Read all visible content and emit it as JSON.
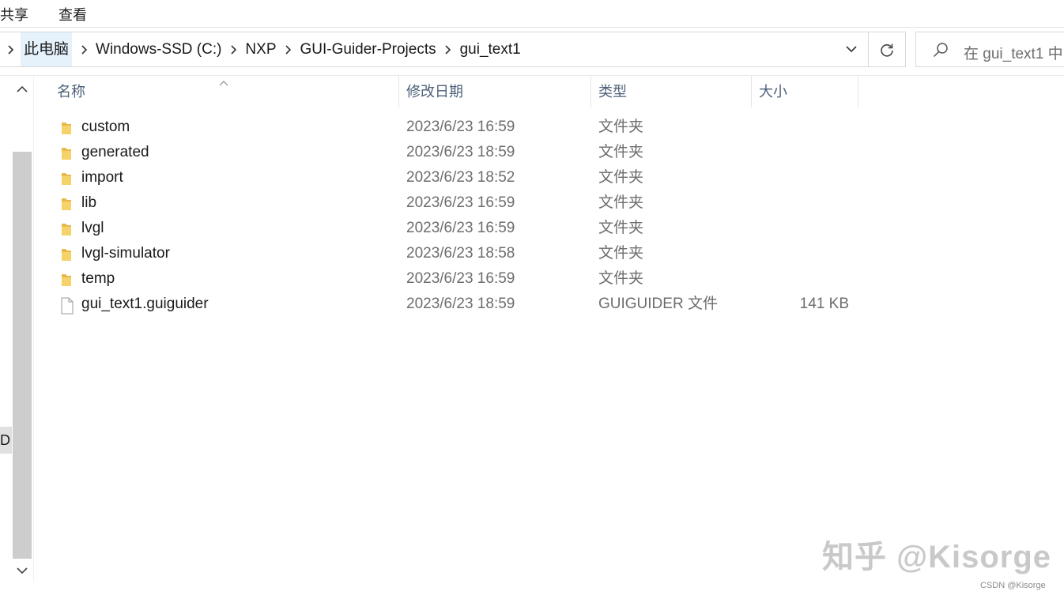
{
  "ribbon": {
    "tabs": [
      "共享",
      "查看"
    ]
  },
  "address_bar": {
    "breadcrumbs": [
      "此电脑",
      "Windows-SSD (C:)",
      "NXP",
      "GUI-Guider-Projects",
      "gui_text1"
    ]
  },
  "search": {
    "placeholder": "在 gui_text1 中"
  },
  "nav_pane": {
    "partial_label": "D"
  },
  "columns": {
    "name": "名称",
    "date": "修改日期",
    "type": "类型",
    "size": "大小"
  },
  "files": [
    {
      "name": "custom",
      "date": "2023/6/23 16:59",
      "type": "文件夹",
      "size": "",
      "icon": "folder-icon"
    },
    {
      "name": "generated",
      "date": "2023/6/23 18:59",
      "type": "文件夹",
      "size": "",
      "icon": "folder-icon"
    },
    {
      "name": "import",
      "date": "2023/6/23 18:52",
      "type": "文件夹",
      "size": "",
      "icon": "folder-icon"
    },
    {
      "name": "lib",
      "date": "2023/6/23 16:59",
      "type": "文件夹",
      "size": "",
      "icon": "folder-icon"
    },
    {
      "name": "lvgl",
      "date": "2023/6/23 16:59",
      "type": "文件夹",
      "size": "",
      "icon": "folder-icon"
    },
    {
      "name": "lvgl-simulator",
      "date": "2023/6/23 18:58",
      "type": "文件夹",
      "size": "",
      "icon": "folder-icon"
    },
    {
      "name": "temp",
      "date": "2023/6/23 16:59",
      "type": "文件夹",
      "size": "",
      "icon": "folder-icon"
    },
    {
      "name": "gui_text1.guiguider",
      "date": "2023/6/23 18:59",
      "type": "GUIGUIDER 文件",
      "size": "141 KB",
      "icon": "file-icon"
    }
  ],
  "watermark": {
    "main": "知乎 @Kisorge",
    "small": "CSDN @Kisorge"
  }
}
